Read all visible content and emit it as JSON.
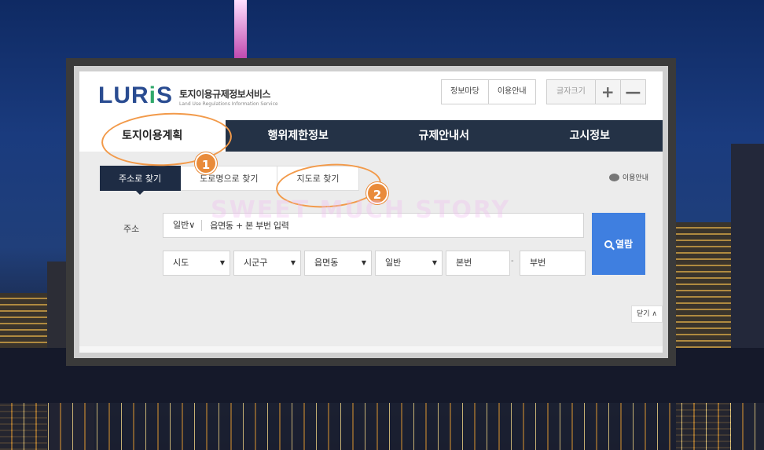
{
  "logo": {
    "mark_a": "LUR",
    "mark_i": "i",
    "mark_b": "S",
    "korean": "토지이용규제정보서비스",
    "english": "Land Use Regulations Information Service"
  },
  "header": {
    "links": [
      "정보마당",
      "이용안내"
    ],
    "font_size_label": "글자크기",
    "plus": "+",
    "minus": "—"
  },
  "nav": {
    "items": [
      "토지이용계획",
      "행위제한정보",
      "규제안내서",
      "고시정보"
    ],
    "active_index": 0
  },
  "sub_tabs": {
    "items": [
      "주소로 찾기",
      "도로명으로 찾기",
      "지도로 찾기"
    ],
    "active_index": 0
  },
  "help_label": "이용안내",
  "address": {
    "label": "주소",
    "type": "일반∨",
    "placeholder": "읍면동 + 본 부번 입력"
  },
  "selects": {
    "sido": "시도",
    "sigungu": "시군구",
    "eupmyeondong": "읍면동",
    "type": "일반",
    "bonbeon": "본번",
    "dash": "-",
    "bubeon": "부번"
  },
  "search_label": "열람",
  "close_label": "닫기 ∧",
  "annotations": {
    "badge1": "1",
    "badge2": "2",
    "watermark": "SWEET MUCH STORY"
  },
  "colors": {
    "nav_bg": "#243246",
    "accent_blue": "#3f7fe0",
    "annotation_orange": "#e98b3a"
  }
}
